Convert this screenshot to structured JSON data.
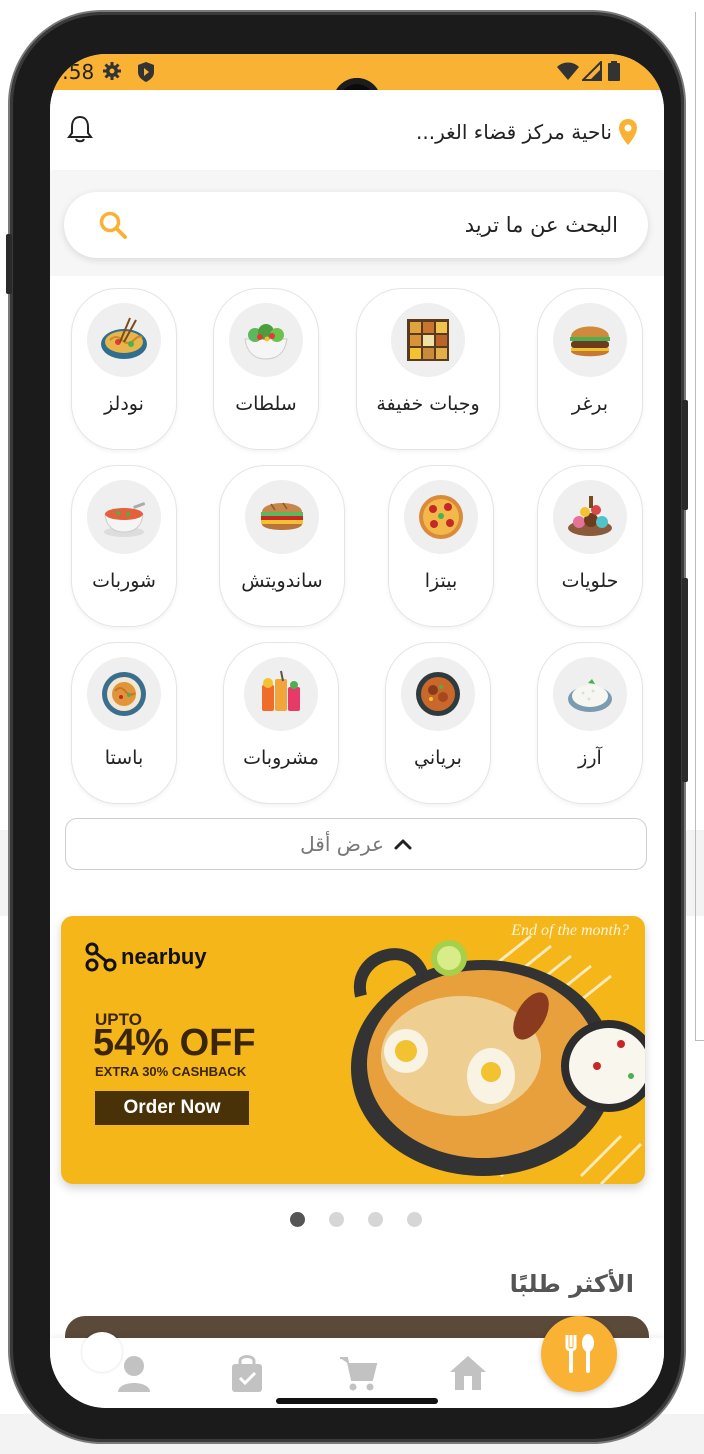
{
  "status_bar": {
    "time": ":58",
    "icons": [
      "gear-icon",
      "shield-icon",
      "wifi-icon",
      "signal-icon",
      "battery-icon"
    ]
  },
  "header": {
    "location": "ناحية مركز قضاء الغر...",
    "icons": [
      "bell-icon",
      "location-pin-icon"
    ]
  },
  "search": {
    "placeholder": "البحث عن ما تريد"
  },
  "categories": [
    {
      "label": "برغر",
      "icon": "burger-icon"
    },
    {
      "label": "وجبات خفيفة",
      "icon": "snacks-icon"
    },
    {
      "label": "سلطات",
      "icon": "salad-icon"
    },
    {
      "label": "نودلز",
      "icon": "noodles-icon"
    },
    {
      "label": "حلويات",
      "icon": "dessert-icon"
    },
    {
      "label": "بيتزا",
      "icon": "pizza-icon"
    },
    {
      "label": "ساندويتش",
      "icon": "sandwich-icon"
    },
    {
      "label": "شوربات",
      "icon": "soup-icon"
    },
    {
      "label": "آرز",
      "icon": "rice-icon"
    },
    {
      "label": "برياني",
      "icon": "biryani-icon"
    },
    {
      "label": "مشروبات",
      "icon": "drinks-icon"
    },
    {
      "label": "باستا",
      "icon": "pasta-icon"
    }
  ],
  "show_less": {
    "label": "عرض أقل",
    "icon": "chevron-up-icon"
  },
  "banner": {
    "brand": "nearbuy",
    "upto": "UPTO",
    "discount": "54% OFF",
    "cashback": "EXTRA 30% CASHBACK",
    "cta": "Order Now",
    "corner_text": "End of the month?"
  },
  "carousel": {
    "count": 4,
    "active_index": 0
  },
  "section": {
    "title": "الأكثر طلبًا"
  },
  "bottom_nav": {
    "items": [
      "profile-icon",
      "orders-bag-icon",
      "cart-icon",
      "home-icon"
    ],
    "fab_icon": "fork-spoon-icon"
  },
  "colors": {
    "accent": "#f9b233",
    "text": "#222222",
    "muted": "#777777"
  }
}
